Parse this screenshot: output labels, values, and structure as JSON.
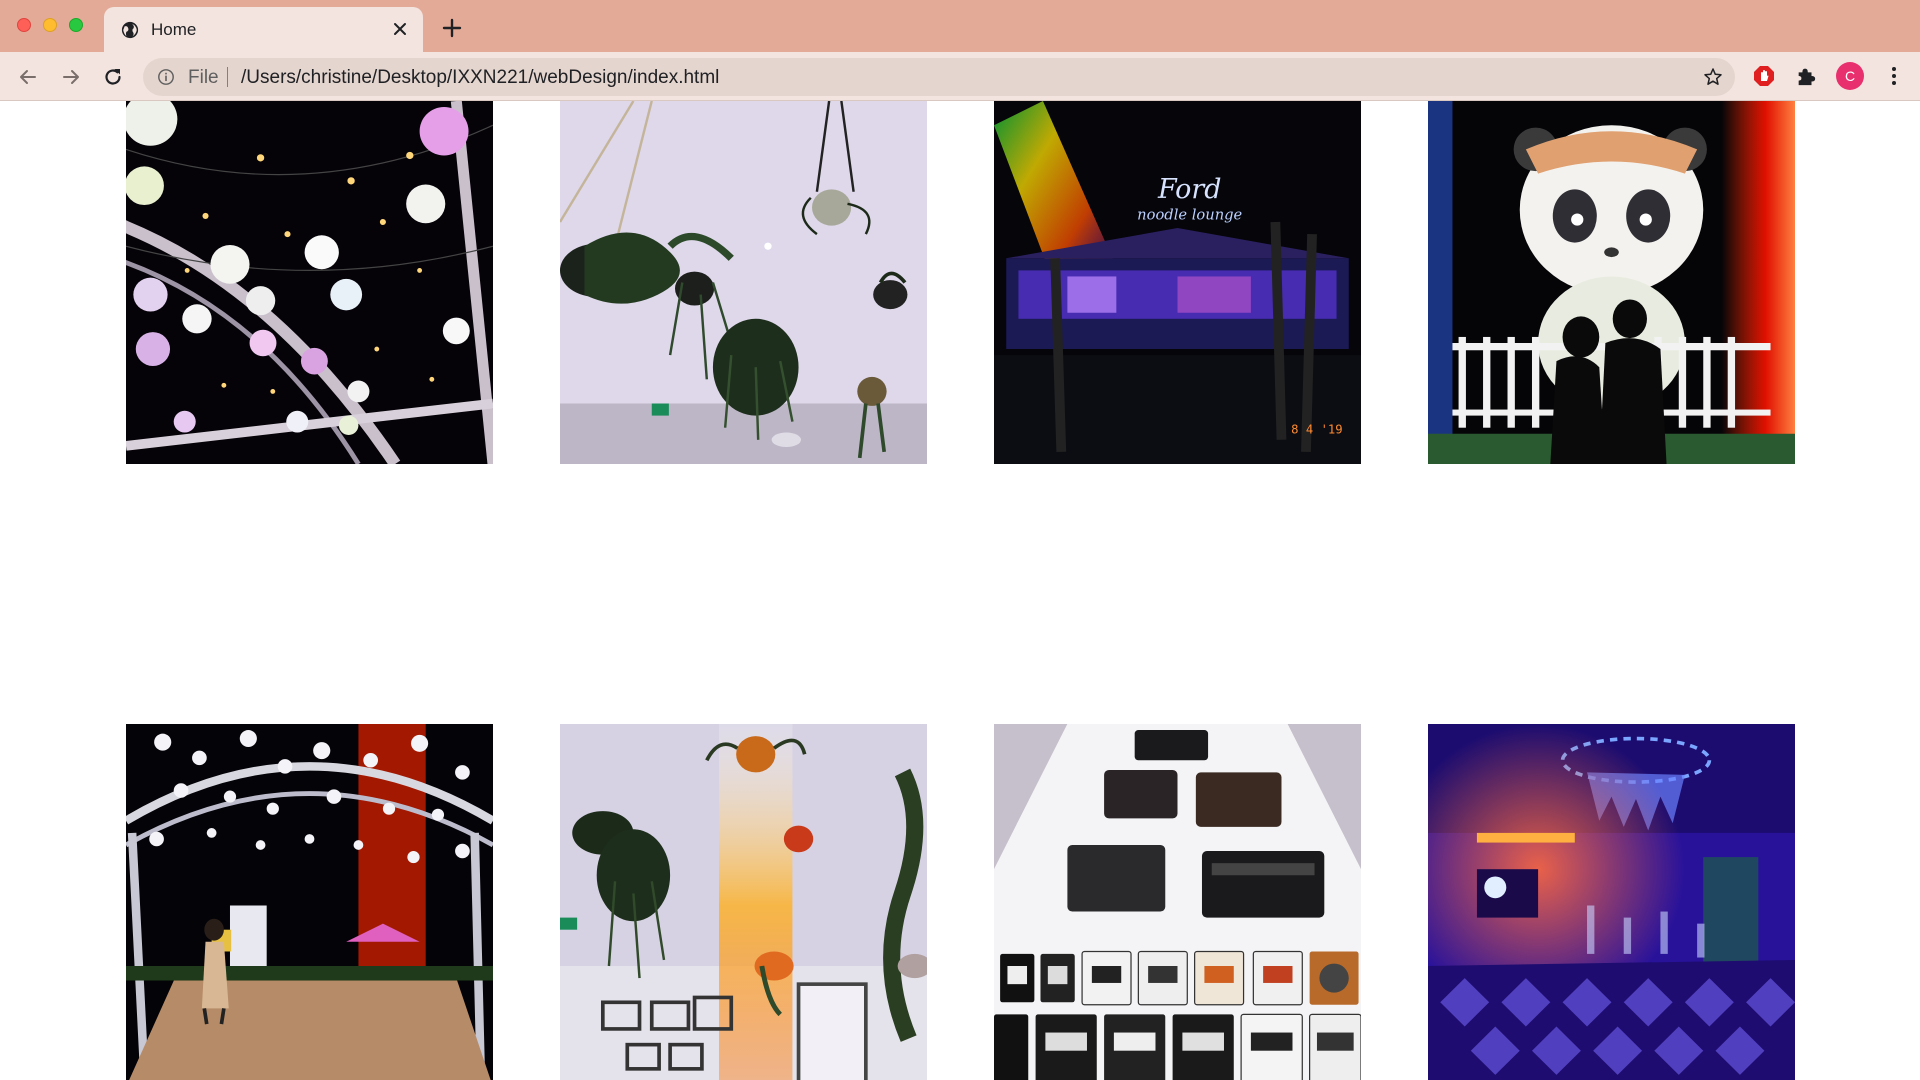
{
  "browser": {
    "tab": {
      "title": "Home",
      "favicon": "globe-icon",
      "close": "close-icon"
    },
    "toolbar": {
      "scheme_label": "File",
      "url": "/Users/christine/Desktop/IXXN221/webDesign/index.html",
      "avatar_initial": "C",
      "icons": [
        "back-arrow-icon",
        "forward-arrow-icon",
        "reload-icon",
        "info-icon",
        "star-icon",
        "adblock-icon",
        "puzzle-icon",
        "kebab-menu-icon"
      ]
    },
    "colors": {
      "tabbar": "#e3aa98",
      "toolbar": "#f3e4df",
      "omnibox": "#e5d5cf",
      "avatar": "#e8306e"
    }
  },
  "gallery": {
    "photos": [
      {
        "subject": "Lanterns and string lights on steel truss at night",
        "overlay_text": ""
      },
      {
        "subject": "Hanging potted plants from a white ceiling",
        "overlay_text": ""
      },
      {
        "subject": "Neon sign over a lit pavilion at night",
        "overlay_text": "8 4 '19"
      },
      {
        "subject": "Giant inflatable panda behind a white picket fence",
        "overlay_text": ""
      },
      {
        "subject": "Lantern archway over a wooden dance floor",
        "overlay_text": ""
      },
      {
        "subject": "Hanging plants with a rainbow light leak",
        "overlay_text": ""
      },
      {
        "subject": "Vintage cassette players and tapes on display",
        "overlay_text": ""
      },
      {
        "subject": "Purple-lit room with a chandelier",
        "overlay_text": ""
      }
    ]
  }
}
